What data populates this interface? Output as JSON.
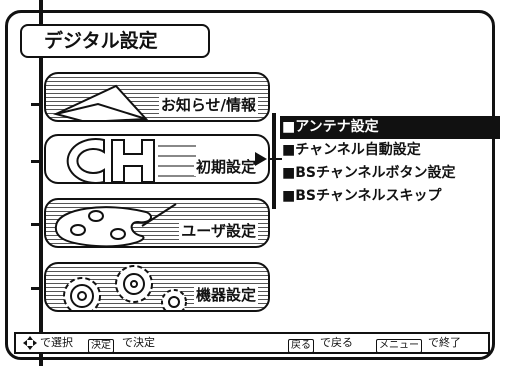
{
  "title": "デジタル設定",
  "menu": [
    {
      "label": "お知らせ/情報",
      "icon": "envelope-icon"
    },
    {
      "label": "初期設定",
      "icon": "ch-icon"
    },
    {
      "label": "ユーザ設定",
      "icon": "palette-icon"
    },
    {
      "label": "機器設定",
      "icon": "gears-icon"
    }
  ],
  "submenu": [
    {
      "label": "■アンテナ設定",
      "selected": true
    },
    {
      "label": "■チャンネル自動設定",
      "selected": false
    },
    {
      "label": "■BSチャンネルボタン設定",
      "selected": false
    },
    {
      "label": "■BSチャンネルスキップ",
      "selected": false
    }
  ],
  "footer": {
    "nav_icon": "dpad-icon",
    "select_text": "で選択",
    "decide_key": "決定",
    "decide_text": "で決定",
    "back_key": "戻る",
    "back_text": "で戻る",
    "menu_key": "メニュー",
    "menu_text": "で終了"
  }
}
